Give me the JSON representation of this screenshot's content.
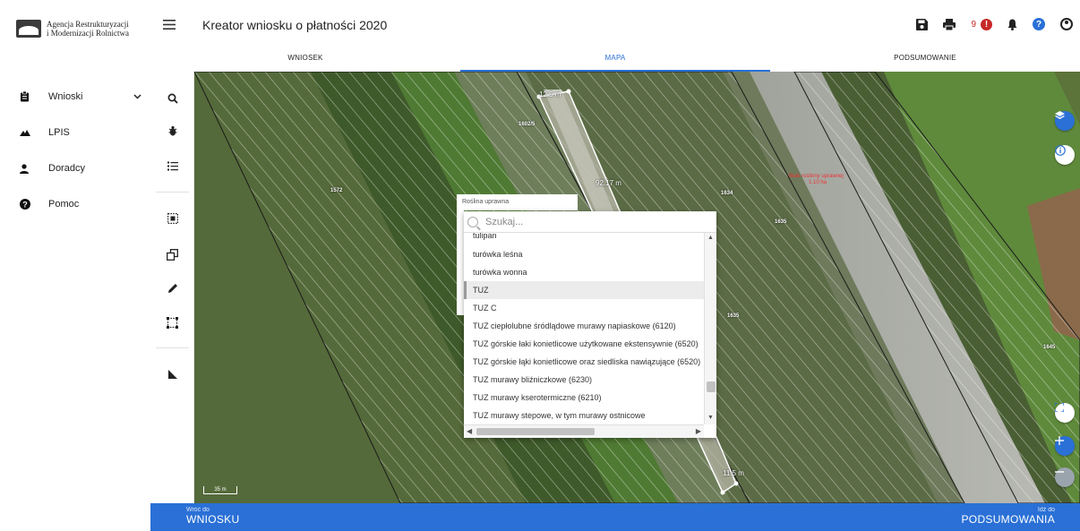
{
  "logo": {
    "line1": "Agencja Restrukturyzacji",
    "line2": "i Modernizacji Rolnictwa"
  },
  "sidebar": {
    "items": [
      {
        "label": "Wnioski",
        "icon": "clipboard-icon",
        "expandable": true
      },
      {
        "label": "LPIS",
        "icon": "mountain-icon"
      },
      {
        "label": "Doradcy",
        "icon": "person-icon"
      },
      {
        "label": "Pomoc",
        "icon": "question-circle-icon"
      }
    ]
  },
  "header": {
    "title": "Kreator wniosku o płatności 2020",
    "notification_count": "9",
    "alert_symbol": "!",
    "help_symbol": "?",
    "icons": [
      "save-icon",
      "print-icon",
      "alert-icon",
      "bell-icon",
      "help-icon",
      "user-icon"
    ]
  },
  "tabs": [
    {
      "label": "WNIOSEK",
      "active": false
    },
    {
      "label": "MAPA",
      "active": true
    },
    {
      "label": "PODSUMOWANIE",
      "active": false
    }
  ],
  "map": {
    "parcel_labels": [
      "1602/5",
      "1572",
      "1634",
      "1635",
      "1635",
      "1645"
    ],
    "dimension_labels": [
      "12.5 m",
      "92.17 m",
      "11.5 m"
    ],
    "warning_line1": "Brak roślinny uprawnej",
    "warning_line2": "1.10 ha",
    "scale": "35 m",
    "colors": {
      "hatch": "#ffffff",
      "accent": "#2a70d6",
      "warning": "#e33333"
    }
  },
  "crop_field": {
    "label": "Roślina uprawna",
    "search_placeholder": "Szukaj...",
    "options": [
      "tulipan",
      "turówka leśna",
      "turówka wonna",
      "TUZ",
      "TUZ C",
      "TUZ ciepłolubne śródlądowe murawy napiaskowe (6120)",
      "TUZ górskie łaki konietlicowe użytkowane ekstensywnie (6520)",
      "TUZ górskie łąki konietlicowe oraz siedliska nawiązujące (6520)",
      "TUZ murawy bliźniczkowe (6230)",
      "TUZ murawy kserotermiczne (6210)",
      "TUZ murawy stepowe, w tym murawy ostnicowe"
    ],
    "selected": "TUZ"
  },
  "footer": {
    "back_small": "Wróć do",
    "back_big": "WNIOSKU",
    "next_small": "Idź do",
    "next_big": "PODSUMOWANIA"
  }
}
